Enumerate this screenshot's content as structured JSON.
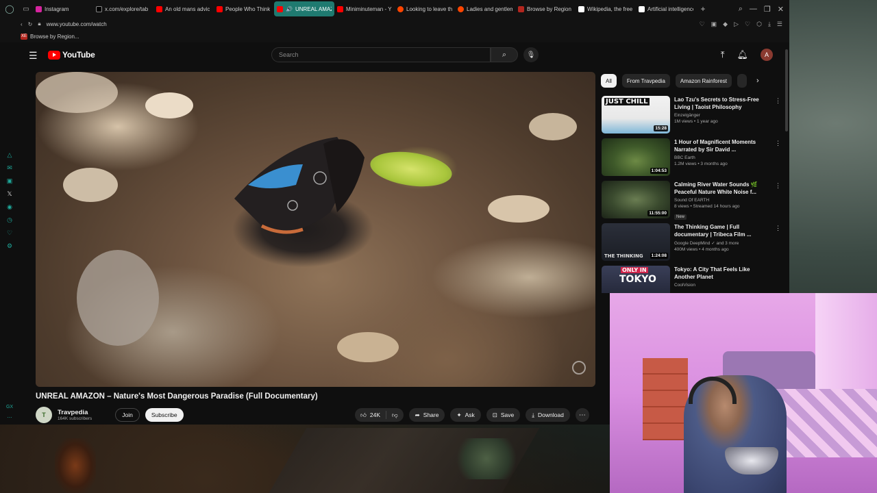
{
  "browser": {
    "tabs": [
      {
        "title": "Instagram",
        "color": "#d6249f",
        "active": false
      },
      {
        "title": "x.com/explore/tab",
        "color": "#000000",
        "active": false
      },
      {
        "title": "An old mans advic",
        "color": "#ff0000",
        "active": false
      },
      {
        "title": "People Who Think",
        "color": "#ff0000",
        "active": false
      },
      {
        "title": "UNREAL AMAZON – N",
        "color": "#ff0000",
        "active": true
      },
      {
        "title": "Miniminuteman - Y",
        "color": "#ff0000",
        "active": false
      },
      {
        "title": "Looking to leave th",
        "color": "#ff4500",
        "active": false
      },
      {
        "title": "Ladies and gentlem",
        "color": "#ff4500",
        "active": false
      },
      {
        "title": "Browse by Region",
        "color": "#b3261e",
        "active": false
      },
      {
        "title": "Wikipedia, the free",
        "color": "#ffffff",
        "active": false
      },
      {
        "title": "Artificial intelligence",
        "color": "#ffffff",
        "active": false
      }
    ],
    "url": "www.youtube.com/watch",
    "bookmark": {
      "icon_text": "XE",
      "label": "Browse by Region..."
    }
  },
  "youtube": {
    "logo_text": "YouTube",
    "search_placeholder": "Search",
    "avatar_letter": "A",
    "video": {
      "title": "UNREAL AMAZON – Nature's Most Dangerous Paradise (Full Documentary)",
      "channel": "Travpedia",
      "subscribers": "164K subscribers",
      "join_label": "Join",
      "subscribe_label": "Subscribe",
      "likes": "24K",
      "share_label": "Share",
      "ask_label": "Ask",
      "save_label": "Save",
      "download_label": "Download"
    },
    "chips": [
      "All",
      "From Travpedia",
      "Amazon Rainforest"
    ],
    "recommendations": [
      {
        "title": "Lao Tzu's Secrets to Stress-Free Living | Taoist Philosophy",
        "channel": "Einzelgänger",
        "meta": "1M views • 1 year ago",
        "duration": "15:28",
        "thumb_text": "JUST CHILL",
        "badge": ""
      },
      {
        "title": "1 Hour of Magnificent Moments Narrated by Sir David ...",
        "channel": "BBC Earth",
        "meta": "1.2M views • 3 months ago",
        "duration": "1:04:53",
        "thumb_text": "",
        "badge": ""
      },
      {
        "title": "Calming River Water Sounds 🌿 Peaceful Nature White Noise f...",
        "channel": "Sound Of EARTH",
        "meta": "8 views • Streamed 14 hours ago",
        "duration": "11:55:00",
        "thumb_text": "",
        "badge": "New"
      },
      {
        "title": "The Thinking Game | Full documentary | Tribeca Film ...",
        "channel": "Google DeepMind",
        "meta": "400M views • 4 months ago",
        "duration": "1:24:08",
        "thumb_text": "THE THINKING",
        "channel_extra": "and 3 more"
      },
      {
        "title": "Tokyo: A City That Feels Like Another Planet",
        "channel": "CoolVision",
        "meta": "",
        "duration": "",
        "thumb_text": "TOKYO",
        "thumb_text_top": "ONLY IN",
        "badge": ""
      }
    ]
  }
}
